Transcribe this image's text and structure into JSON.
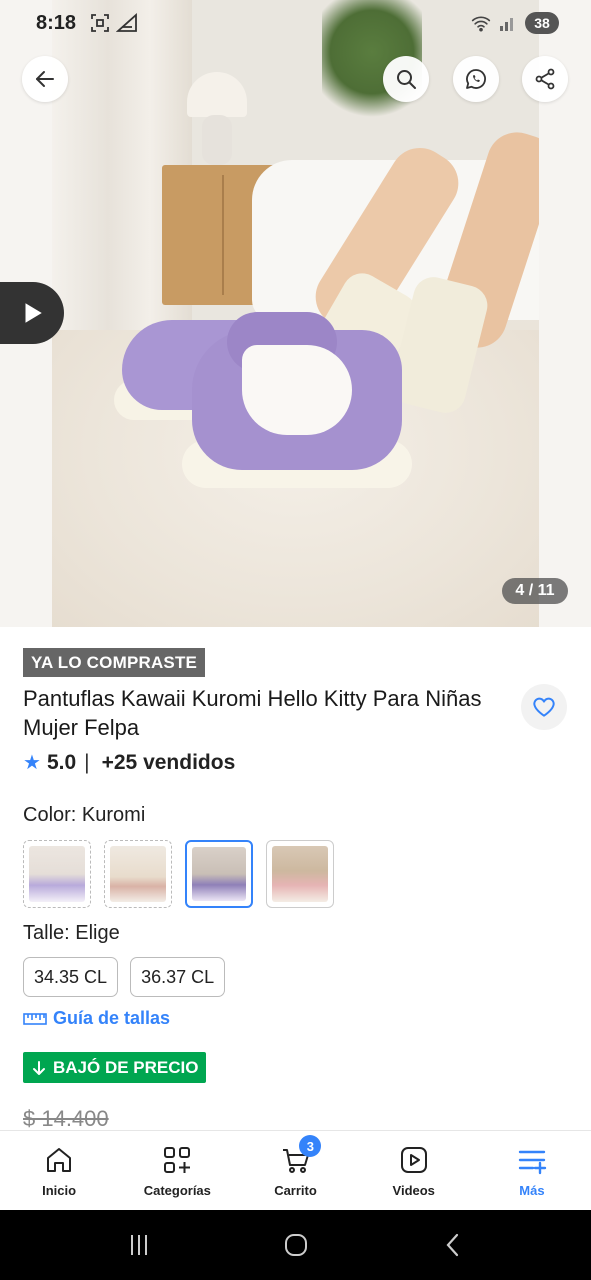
{
  "status_bar": {
    "time": "8:18",
    "battery": "38"
  },
  "gallery": {
    "counter": "4 / 11"
  },
  "product": {
    "bought_tag": "YA LO COMPRASTE",
    "title": "Pantuflas Kawaii Kuromi Hello Kitty Para Niñas Mujer Felpa",
    "rating": "5.0",
    "separator": "|",
    "sold": "+25 vendidos",
    "color_label": "Color: Kuromi",
    "color_options": [
      {
        "name": "variant-1",
        "selected": false
      },
      {
        "name": "variant-2",
        "selected": false
      },
      {
        "name": "kuromi",
        "selected": true
      },
      {
        "name": "variant-4",
        "selected": false
      }
    ],
    "size_label": "Talle: Elige",
    "sizes": [
      "34.35 CL",
      "36.37 CL"
    ],
    "size_guide": "Guía de tallas",
    "price_drop": "BAJÓ DE PRECIO",
    "old_price": "$ 14.400"
  },
  "bottom_nav": {
    "items": [
      {
        "label": "Inicio",
        "icon": "home-icon"
      },
      {
        "label": "Categorías",
        "icon": "categories-icon"
      },
      {
        "label": "Carrito",
        "icon": "cart-icon",
        "badge": "3"
      },
      {
        "label": "Videos",
        "icon": "video-icon"
      },
      {
        "label": "Más",
        "icon": "menu-plus-icon",
        "active": true
      }
    ]
  },
  "colors": {
    "accent": "#3483fa",
    "success": "#00a650"
  }
}
